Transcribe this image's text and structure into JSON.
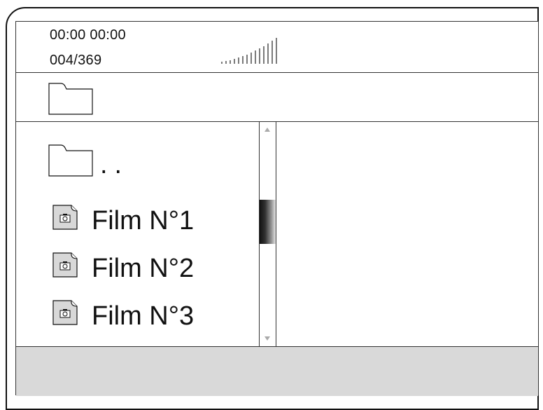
{
  "status": {
    "time": "00:00 00:00",
    "track_counter": "004/369",
    "volume_level": 1.0
  },
  "path": {
    "icon": "folder-icon"
  },
  "file_list": {
    "parent_label": "..",
    "items": [
      {
        "label": "Film N°1",
        "icon": "photo-file-icon"
      },
      {
        "label": "Film N°2",
        "icon": "photo-file-icon"
      },
      {
        "label": "Film N°3",
        "icon": "photo-file-icon"
      }
    ]
  },
  "scrollbar": {
    "thumb_position": 0.35
  }
}
